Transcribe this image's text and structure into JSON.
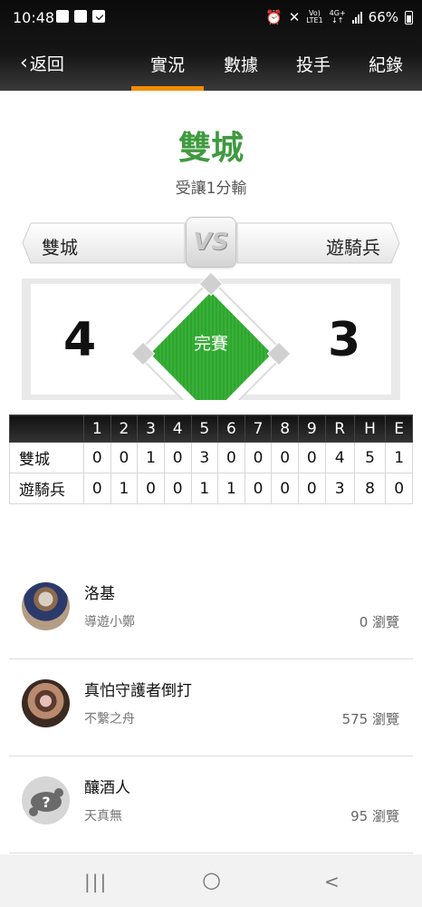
{
  "status_bar": {
    "time": "10:48",
    "network_top": "Vo)",
    "network_bottom": "LTE1",
    "net_type_top": "4G+",
    "net_type_bottom": "↓↑",
    "battery": "66%"
  },
  "nav": {
    "back_label": "返回",
    "tabs": [
      "實況",
      "數據",
      "投手",
      "紀錄"
    ],
    "active_tab": "實況",
    "accent_color": "#f08c00"
  },
  "result": {
    "winner": "雙城",
    "summary": "受讓1分輸",
    "winner_color": "#3f9a3f"
  },
  "matchup": {
    "vs_label": "VS",
    "away_team": "雙城",
    "home_team": "遊騎兵"
  },
  "score": {
    "away": "4",
    "home": "3",
    "status": "完賽",
    "field_color": "#2fa52f"
  },
  "linescore": {
    "headers": [
      "",
      "1",
      "2",
      "3",
      "4",
      "5",
      "6",
      "7",
      "8",
      "9",
      "R",
      "H",
      "E"
    ],
    "rows": [
      {
        "team": "雙城",
        "values": [
          "0",
          "0",
          "1",
          "0",
          "3",
          "0",
          "0",
          "0",
          "0",
          "4",
          "5",
          "1"
        ]
      },
      {
        "team": "遊騎兵",
        "values": [
          "0",
          "1",
          "0",
          "0",
          "1",
          "1",
          "0",
          "0",
          "0",
          "3",
          "8",
          "0"
        ]
      }
    ]
  },
  "posts": [
    {
      "title": "洛基",
      "author": "導遊小鄭",
      "views": "0 瀏覽"
    },
    {
      "title": "真怕守護者倒打",
      "author": "不繫之舟",
      "views": "575 瀏覽"
    },
    {
      "title": "釀酒人",
      "author": "天真無",
      "views": "95 瀏覽"
    }
  ],
  "system_nav": {
    "recents": "|||",
    "home": "○",
    "back": "<"
  }
}
